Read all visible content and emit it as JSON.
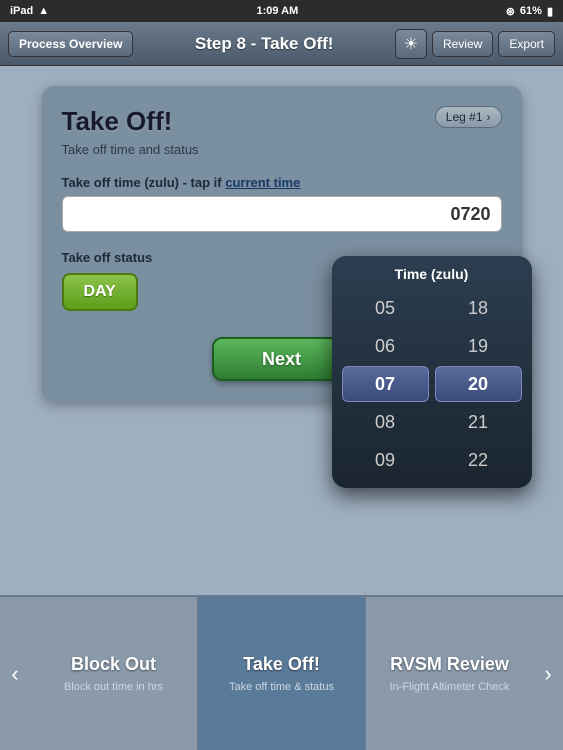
{
  "status_bar": {
    "carrier": "iPad",
    "time": "1:09 AM",
    "bluetooth": "61%",
    "battery_icon": "🔋"
  },
  "nav_bar": {
    "process_overview_label": "Process Overview",
    "title": "Step 8 - Take Off!",
    "brightness_icon": "☀",
    "review_label": "Review",
    "export_label": "Export"
  },
  "card": {
    "title": "Take Off!",
    "subtitle": "Take off time and status",
    "leg_badge": "Leg #1",
    "time_field_label": "Take off time (zulu) - tap if",
    "current_time_link": "current time",
    "time_value": "0720",
    "status_field_label": "Take off status",
    "status_button_label": "DAY",
    "next_button_label": "Next"
  },
  "time_picker": {
    "title": "Time (zulu)",
    "hours": [
      "05",
      "06",
      "07",
      "08",
      "09"
    ],
    "minutes": [
      "18",
      "19",
      "20",
      "21",
      "22"
    ],
    "selected_hour": "07",
    "selected_minute": "20"
  },
  "bottom_nav": {
    "left_arrow": "‹",
    "right_arrow": "›",
    "items": [
      {
        "title": "Block Out",
        "subtitle": "Block out time in hrs",
        "active": false
      },
      {
        "title": "Take Off!",
        "subtitle": "Take off time & status",
        "active": true
      },
      {
        "title": "RVSM Review",
        "subtitle": "In-Flight Altimeter Check",
        "active": false
      }
    ]
  }
}
